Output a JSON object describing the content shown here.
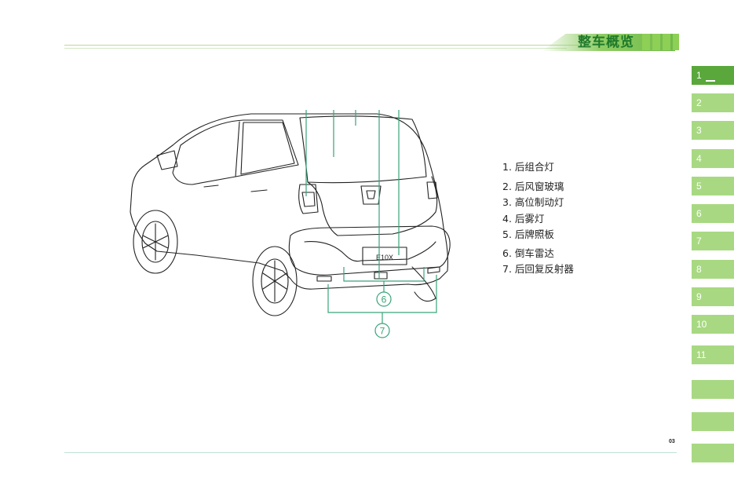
{
  "header": {
    "title": "整车概览"
  },
  "side_tabs": [
    {
      "label": "1",
      "active": true
    },
    {
      "label": "2"
    },
    {
      "label": "3"
    },
    {
      "label": "4"
    },
    {
      "label": "5"
    },
    {
      "label": "6"
    },
    {
      "label": "7"
    },
    {
      "label": "8"
    },
    {
      "label": "9"
    },
    {
      "label": "10"
    },
    {
      "label": "11"
    },
    {
      "label": ""
    },
    {
      "label": ""
    },
    {
      "label": ""
    }
  ],
  "figure": {
    "plate_text": "E10X",
    "callouts": [
      "6",
      "7"
    ]
  },
  "legend": [
    "1. 后组合灯",
    "2. 后风窗玻璃",
    "3. 高位制动灯",
    "4. 后雾灯",
    "5. 后牌照板",
    "6. 倒车雷达",
    "7. 后回复反射器"
  ],
  "footer": {
    "page_number": "03"
  },
  "colors": {
    "accent_green": "#5aa83c",
    "tab_green": "#a8d982",
    "title_green": "#1f7a2a",
    "leader_green": "#3aa37a"
  }
}
